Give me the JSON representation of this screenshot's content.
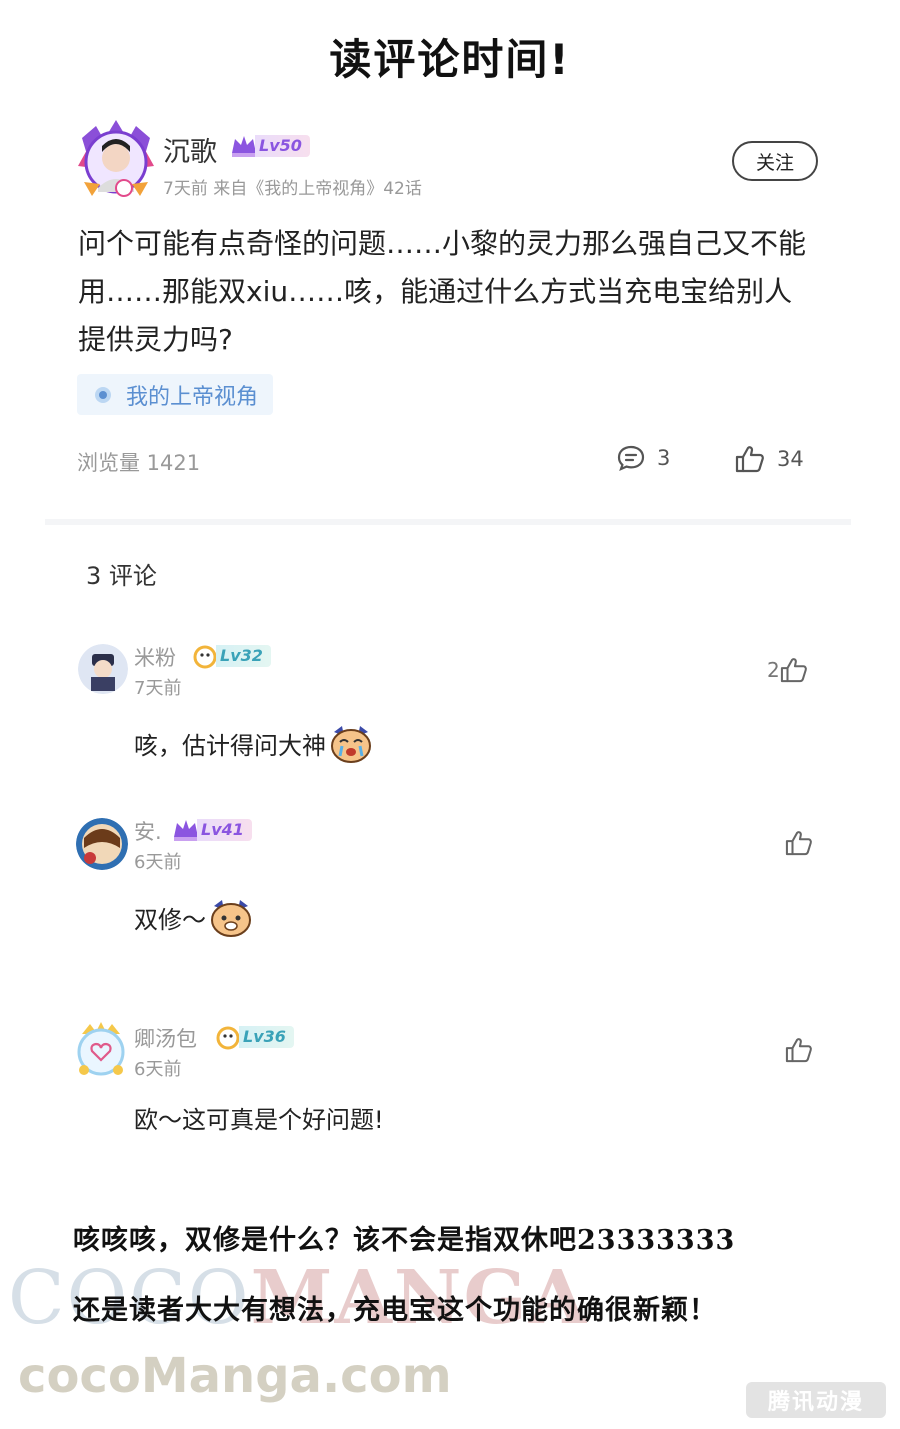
{
  "page_title": "读评论时间!",
  "post": {
    "author": "沉歌",
    "level": "Lv50",
    "meta": "7天前 来自《我的上帝视角》42话",
    "follow_label": "关注",
    "body": "问个可能有点奇怪的问题……小黎的灵力那么强自己又不能用……那能双xiu……咳，能通过什么方式当充电宝给别人提供灵力吗?",
    "topic": "我的上帝视角",
    "views": "浏览量 1421",
    "comment_count": "3",
    "like_count": "34"
  },
  "comments_header": "3 评论",
  "comments": [
    {
      "name": "米粉",
      "level": "Lv32",
      "time": "7天前",
      "text": "咳，估计得问大神",
      "likes": "2"
    },
    {
      "name": "安.",
      "level": "Lv41",
      "time": "6天前",
      "text": "双修～",
      "likes": ""
    },
    {
      "name": "卿汤包",
      "level": "Lv36",
      "time": "6天前",
      "text": "欧～这可真是个好问题!",
      "likes": ""
    }
  ],
  "notes": [
    "咳咳咳，双修是什么？该不会是指双休吧23333333",
    "还是读者大大有想法，充电宝这个功能的确很新颖！"
  ],
  "watermark": {
    "big_a": "COCO",
    "big_b": "MANGA",
    "url": "cocoManga.com",
    "logo": "腾讯动漫"
  },
  "colors": {
    "accent_blue": "#5b8fd1",
    "level_purple": "#8a55e0",
    "level_teal": "#3aa2b8"
  }
}
